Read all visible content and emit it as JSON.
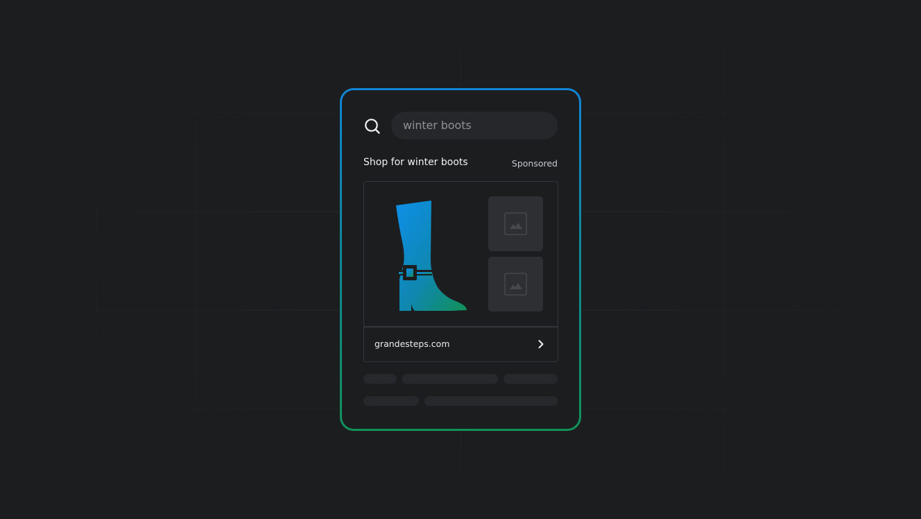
{
  "search": {
    "query": "winter boots",
    "icon": "search-icon"
  },
  "ad": {
    "heading": "Shop for winter boots",
    "sponsored_label": "Sponsored",
    "domain": "grandesteps.com",
    "product_icon": "boot-icon",
    "thumbnail_icon": "image-placeholder-icon",
    "link_icon": "chevron-right-icon"
  },
  "colors": {
    "background": "#1c1d1f",
    "card_border_start": "#1185d6",
    "card_border_end": "#12935a",
    "boot_gradient_start": "#0d8fe8",
    "boot_gradient_end": "#129157"
  }
}
